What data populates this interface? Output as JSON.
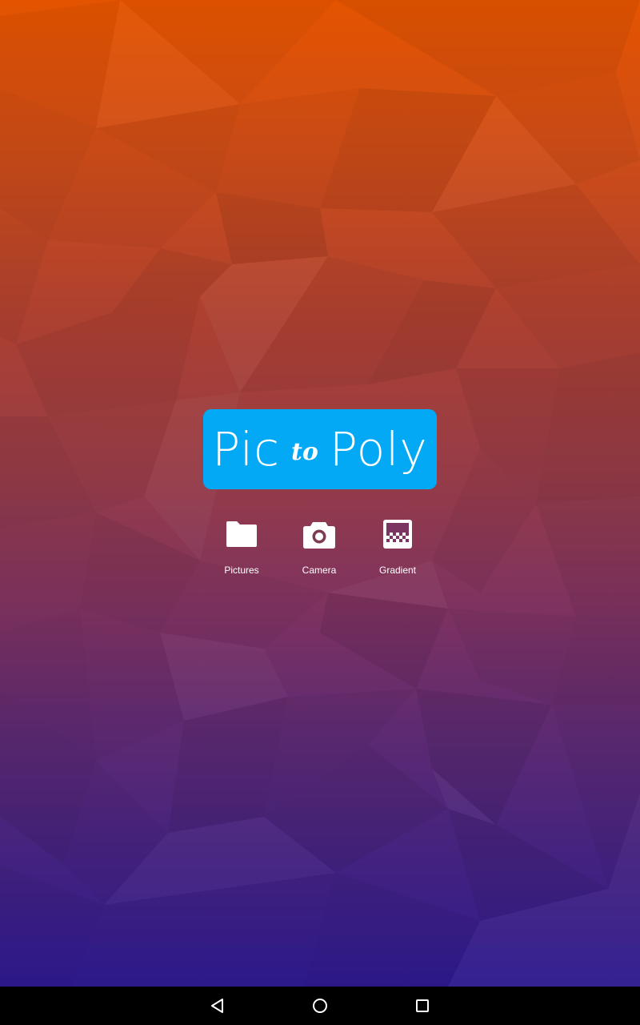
{
  "app": {
    "logo": {
      "word_pic": "Pic",
      "word_to": "to",
      "word_poly": "Poly"
    }
  },
  "actions": [
    {
      "label": "Pictures",
      "icon": "folder-icon"
    },
    {
      "label": "Camera",
      "icon": "camera-icon"
    },
    {
      "label": "Gradient",
      "icon": "gradient-icon"
    }
  ],
  "navigation_bar": {
    "back_icon": "back-triangle-icon",
    "home_icon": "home-circle-icon",
    "recents_icon": "recents-square-icon"
  },
  "colors": {
    "logo_background": "#03a9f4",
    "gradient_top": "#e45400",
    "gradient_bottom": "#2e1a8f",
    "nav_bar": "#000000"
  }
}
